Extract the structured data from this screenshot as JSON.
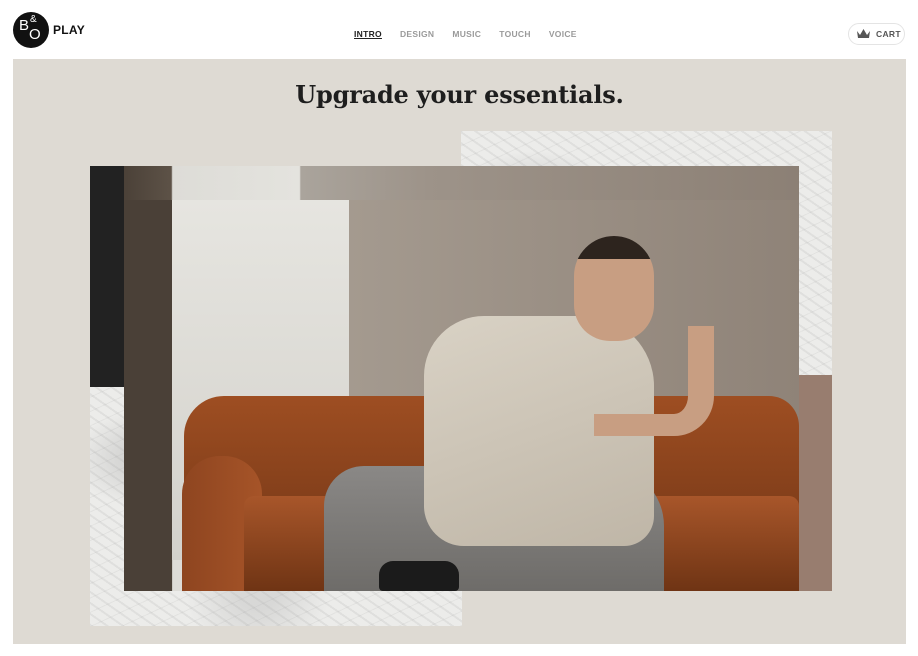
{
  "brand": {
    "logo_letters": "B&O",
    "logo_label": "PLAY"
  },
  "nav": {
    "items": [
      {
        "label": "INTRO",
        "active": true
      },
      {
        "label": "DESIGN",
        "active": false
      },
      {
        "label": "MUSIC",
        "active": false
      },
      {
        "label": "TOUCH",
        "active": false
      },
      {
        "label": "VOICE",
        "active": false
      }
    ]
  },
  "cart": {
    "label": "CART",
    "icon": "crown-cart-icon"
  },
  "hero": {
    "headline": "Upgrade your essentials.",
    "background_color": "#dedad3",
    "accent_dark": "#222222",
    "accent_taupe": "#987d6f"
  }
}
